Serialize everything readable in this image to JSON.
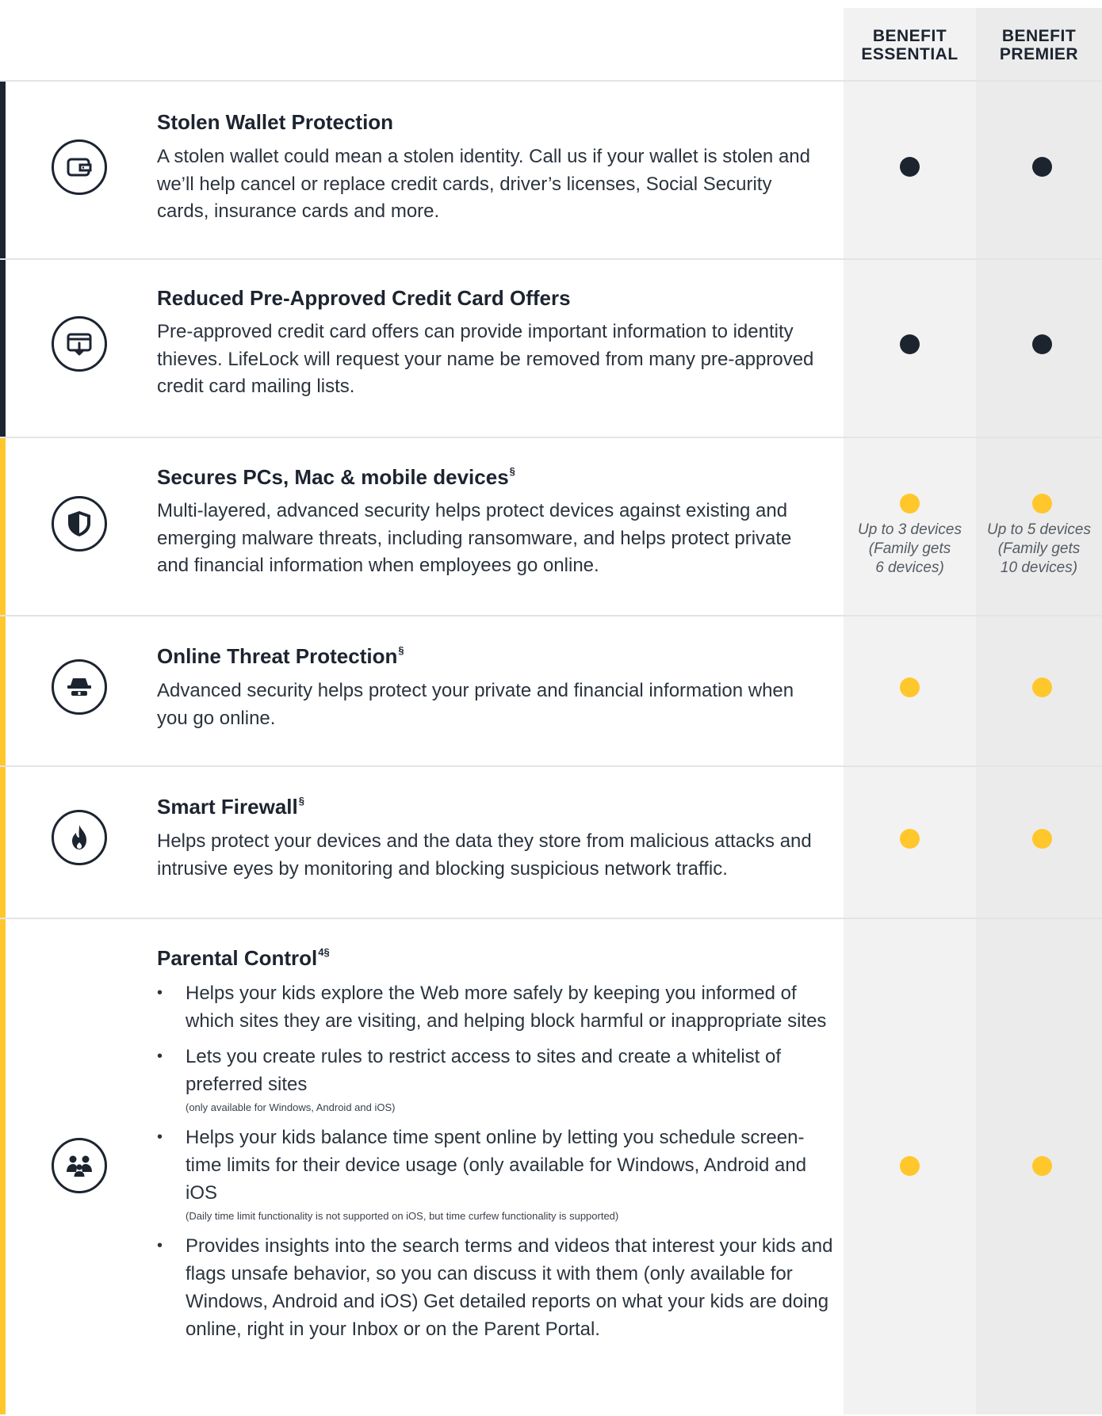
{
  "columns": {
    "essential": "BENEFIT\nESSENTIAL",
    "premier": "BENEFIT\nPREMIER"
  },
  "colors": {
    "dark": "#1c2430",
    "yellow": "#ffc72c"
  },
  "rows": [
    {
      "title": "Stolen Wallet Protection",
      "sup": "",
      "icon": "wallet-icon",
      "description": "A stolen wallet could mean a stolen identity. Call us if your wallet is stolen and we’ll help cancel or replace credit cards, driver’s licenses, Social Security cards, insurance cards and more.",
      "essential": "included",
      "premier": "included"
    },
    {
      "title": "Reduced Pre-Approved Credit Card Offers",
      "sup": "",
      "icon": "credit-card-download-icon",
      "description": "Pre-approved credit card offers can provide important information to identity thieves. LifeLock will request your name be removed from many pre-approved credit card mailing lists.",
      "essential": "included",
      "premier": "included"
    },
    {
      "title": "Secures PCs, Mac & mobile devices",
      "sup": "§",
      "icon": "shield-icon",
      "description": "Multi-layered, advanced security helps protect devices against existing and emerging malware threats, including ransomware, and helps protect private and financial information when employees go online.",
      "essential": "included",
      "essential_note": "Up to 3 devices\n(Family gets\n6 devices)",
      "premier": "included",
      "premier_note": "Up to 5 devices\n(Family gets\n10 devices)"
    },
    {
      "title": "Online Threat Protection",
      "sup": "§",
      "icon": "incognito-icon",
      "description": "Advanced security helps protect your private and financial information when you go online.",
      "essential": "included",
      "premier": "included"
    },
    {
      "title": "Smart Firewall",
      "sup": "§",
      "icon": "flame-icon",
      "description": "Helps protect your devices and the data they store from malicious attacks and intrusive eyes by monitoring and blocking suspicious network traffic.",
      "essential": "included",
      "premier": "included"
    },
    {
      "title": "Parental Control",
      "sup": "4§",
      "icon": "family-icon",
      "bullets": [
        {
          "text": "Helps your kids explore the Web more safely by keeping you informed of which sites they are visiting, and helping block harmful or inappropriate sites",
          "note": ""
        },
        {
          "text": "Lets you create rules to restrict access to sites and create a whitelist of preferred sites",
          "note": "(only available for Windows, Android and iOS)"
        },
        {
          "text": "Helps your kids balance time spent online by letting you schedule screen-time limits for their device usage (only available for Windows, Android and iOS",
          "note": "(Daily time limit functionality is not supported on iOS, but time curfew functionality is supported)"
        },
        {
          "text": "Provides insights into the search terms and videos that interest your kids and flags unsafe behavior, so you can discuss it with them (only available for Windows, Android and iOS) Get detailed reports on what your kids are doing online, right in your Inbox or on the Parent Portal.",
          "note": ""
        }
      ],
      "essential": "included",
      "premier": "included"
    }
  ]
}
